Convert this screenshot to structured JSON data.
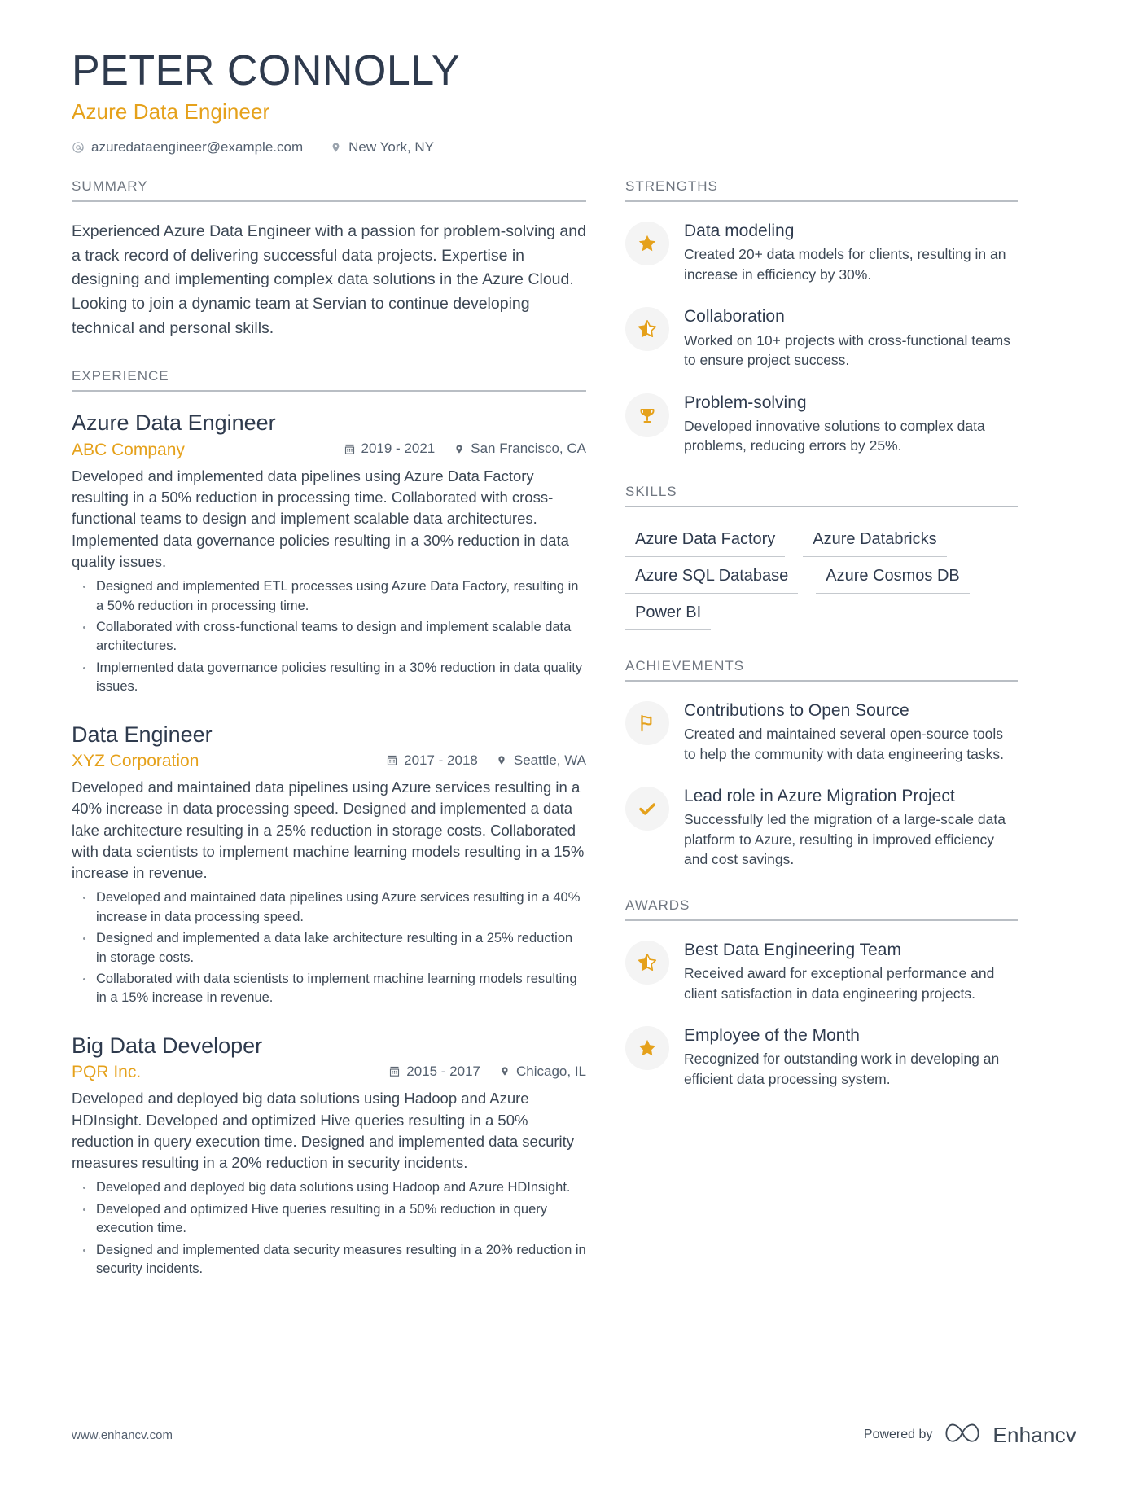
{
  "header": {
    "name": "PETER CONNOLLY",
    "title": "Azure Data Engineer",
    "email": "azuredataengineer@example.com",
    "location": "New York, NY",
    "email_icon": "at-icon",
    "location_icon": "map-pin-icon",
    "accent_color": "#e5a11b",
    "text_color": "#2e3a4d"
  },
  "summary": {
    "heading": "SUMMARY",
    "text": "Experienced Azure Data Engineer with a passion for problem-solving and a track record of delivering successful data projects. Expertise in designing and implementing complex data solutions in the Azure Cloud. Looking to join a dynamic team at Servian to continue developing technical and personal skills."
  },
  "experience": {
    "heading": "EXPERIENCE",
    "jobs": [
      {
        "role": "Azure Data Engineer",
        "company": "ABC Company",
        "dates": "2019 - 2021",
        "location": "San Francisco, CA",
        "description": "Developed and implemented data pipelines using Azure Data Factory resulting in a 50% reduction in processing time. Collaborated with cross-functional teams to design and implement scalable data architectures. Implemented data governance policies resulting in a 30% reduction in data quality issues.",
        "bullets": [
          "Designed and implemented ETL processes using Azure Data Factory, resulting in a 50% reduction in processing time.",
          "Collaborated with cross-functional teams to design and implement scalable data architectures.",
          "Implemented data governance policies resulting in a 30% reduction in data quality issues."
        ]
      },
      {
        "role": "Data Engineer",
        "company": "XYZ Corporation",
        "dates": "2017 - 2018",
        "location": "Seattle, WA",
        "description": "Developed and maintained data pipelines using Azure services resulting in a 40% increase in data processing speed. Designed and implemented a data lake architecture resulting in a 25% reduction in storage costs. Collaborated with data scientists to implement machine learning models resulting in a 15% increase in revenue.",
        "bullets": [
          "Developed and maintained data pipelines using Azure services resulting in a 40% increase in data processing speed.",
          "Designed and implemented a data lake architecture resulting in a 25% reduction in storage costs.",
          "Collaborated with data scientists to implement machine learning models resulting in a 15% increase in revenue."
        ]
      },
      {
        "role": "Big Data Developer",
        "company": "PQR Inc.",
        "dates": "2015 - 2017",
        "location": "Chicago, IL",
        "description": "Developed and deployed big data solutions using Hadoop and Azure HDInsight. Developed and optimized Hive queries resulting in a 50% reduction in query execution time. Designed and implemented data security measures resulting in a 20% reduction in security incidents.",
        "bullets": [
          "Developed and deployed big data solutions using Hadoop and Azure HDInsight.",
          "Developed and optimized Hive queries resulting in a 50% reduction in query execution time.",
          "Designed and implemented data security measures resulting in a 20% reduction in security incidents."
        ]
      }
    ]
  },
  "strengths": {
    "heading": "STRENGTHS",
    "items": [
      {
        "icon": "star-icon",
        "title": "Data modeling",
        "desc": "Created 20+ data models for clients, resulting in an increase in efficiency by 30%."
      },
      {
        "icon": "half-star-icon",
        "title": "Collaboration",
        "desc": "Worked on 10+ projects with cross-functional teams to ensure project success."
      },
      {
        "icon": "trophy-icon",
        "title": "Problem-solving",
        "desc": "Developed innovative solutions to complex data problems, reducing errors by 25%."
      }
    ]
  },
  "skills": {
    "heading": "SKILLS",
    "items": [
      "Azure Data Factory",
      "Azure Databricks",
      "Azure SQL Database",
      "Azure Cosmos DB",
      "Power BI"
    ]
  },
  "achievements": {
    "heading": "ACHIEVEMENTS",
    "items": [
      {
        "icon": "flag-icon",
        "title": "Contributions to Open Source",
        "desc": "Created and maintained several open-source tools to help the community with data engineering tasks."
      },
      {
        "icon": "check-icon",
        "title": "Lead role in Azure Migration Project",
        "desc": "Successfully led the migration of a large-scale data platform to Azure, resulting in improved efficiency and cost savings."
      }
    ]
  },
  "awards": {
    "heading": "AWARDS",
    "items": [
      {
        "icon": "half-star-icon",
        "title": "Best Data Engineering Team",
        "desc": "Received award for exceptional performance and client satisfaction in data engineering projects."
      },
      {
        "icon": "star-icon",
        "title": "Employee of the Month",
        "desc": "Recognized for outstanding work in developing an efficient data processing system."
      }
    ]
  },
  "footer": {
    "website": "www.enhancv.com",
    "powered_by": "Powered by",
    "brand": "Enhancv"
  }
}
